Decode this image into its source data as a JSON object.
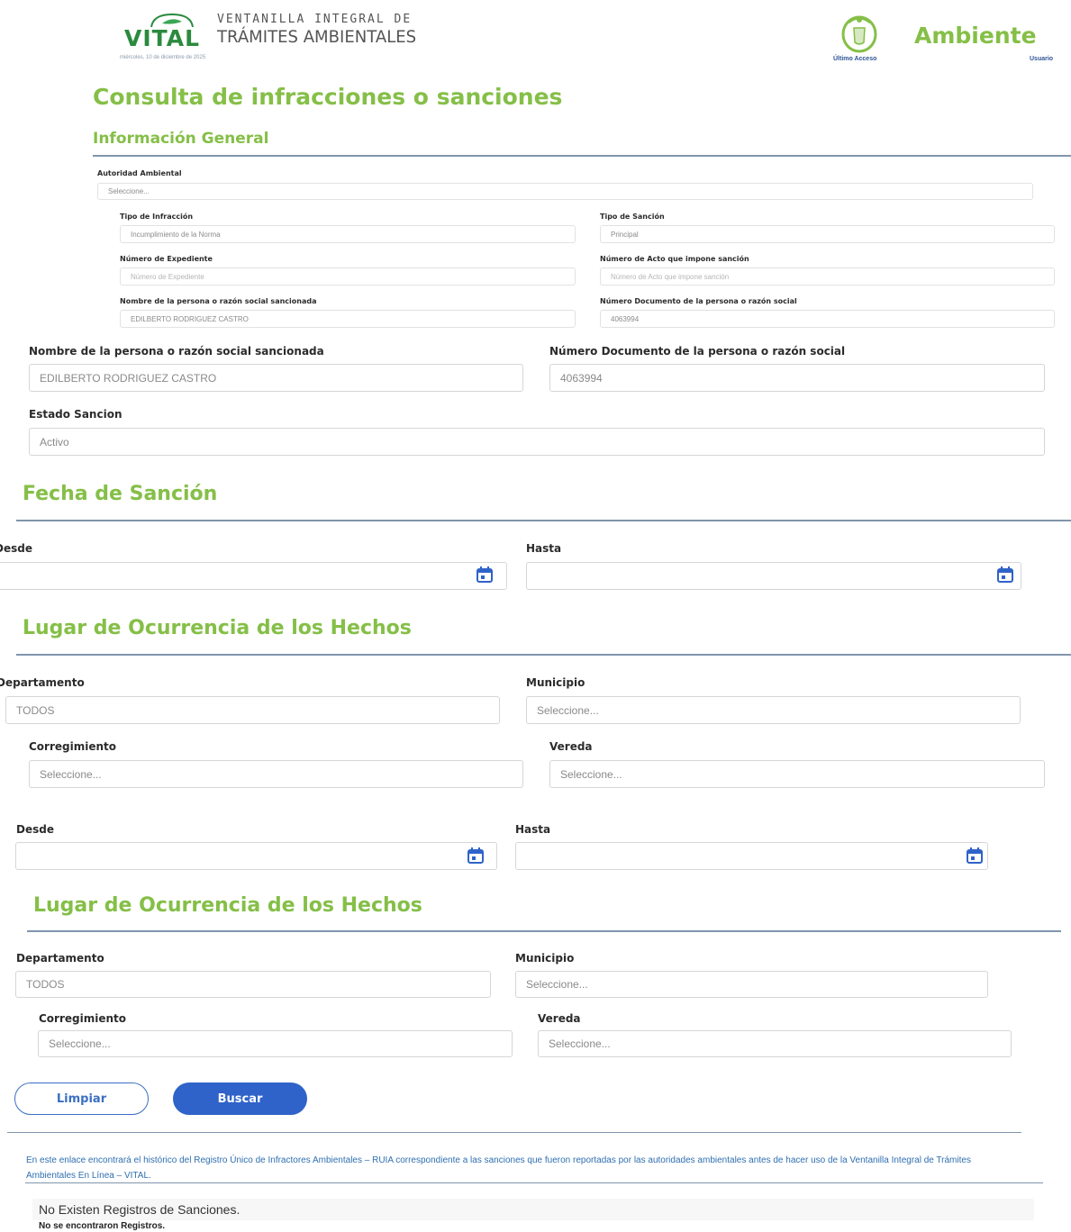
{
  "header": {
    "logo_title": "VITAL",
    "logo_line1": "VENTANILLA INTEGRAL DE",
    "logo_line2": "TRÁMITES AMBIENTALES",
    "date_text": "miércoles, 10 de diciembre de 2025",
    "brand": "Ambiente",
    "last_access_label": "Último Acceso",
    "user_label": "Usuario"
  },
  "page_title": "Consulta de infracciones o sanciones",
  "general": {
    "title": "Información General",
    "autoridad_label": "Autoridad Ambiental",
    "autoridad_value": "Seleccione...",
    "tipo_infraccion_label": "Tipo de Infracción",
    "tipo_infraccion_value": "Incumplimiento de la Norma",
    "tipo_sancion_label": "Tipo de Sanción",
    "tipo_sancion_value": "Principal",
    "num_expediente_label": "Número de Expediente",
    "num_expediente_placeholder": "Número de Expediente",
    "num_acto_label": "Número de Acto que impone sanción",
    "num_acto_placeholder": "Número de Acto que impone sanción",
    "nombre_label": "Nombre de la persona o razón social sancionada",
    "nombre_value": "EDILBERTO RODRIGUEZ CASTRO",
    "documento_label": "Número Documento de la persona o razón social",
    "documento_value": "4063994"
  },
  "detail": {
    "nombre_label": "Nombre de la persona o razón social sancionada",
    "nombre_value": "EDILBERTO RODRIGUEZ CASTRO",
    "documento_label": "Número Documento de la persona o razón social",
    "documento_value": "4063994",
    "estado_label": "Estado Sancion",
    "estado_value": "Activo"
  },
  "fecha": {
    "title": "Fecha de Sanción",
    "desde_label": "Desde",
    "hasta_label": "Hasta"
  },
  "lugar1": {
    "title": "Lugar de Ocurrencia de los Hechos",
    "departamento_label": "Departamento",
    "departamento_value": "TODOS",
    "municipio_label": "Municipio",
    "municipio_value": "Seleccione...",
    "corregimiento_label": "Corregimiento",
    "corregimiento_value": "Seleccione...",
    "vereda_label": "Vereda",
    "vereda_value": "Seleccione..."
  },
  "fecha2": {
    "desde_label": "Desde",
    "hasta_label": "Hasta"
  },
  "lugar2": {
    "title": "Lugar de Ocurrencia de los Hechos",
    "departamento_label": "Departamento",
    "departamento_value": "TODOS",
    "municipio_label": "Municipio",
    "municipio_value": "Seleccione...",
    "corregimiento_label": "Corregimiento",
    "corregimiento_value": "Seleccione...",
    "vereda_label": "Vereda",
    "vereda_value": "Seleccione..."
  },
  "actions": {
    "clear_label": "Limpiar",
    "search_label": "Buscar"
  },
  "footer": {
    "ruia_text": "En este enlace encontrará el histórico del Registro Único de Infractores Ambientales – RUIA correspondiente a las sanciones que fueron reportadas por las autoridades ambientales antes de hacer uso de la Ventanilla Integral de Trámites Ambientales En Línea – VITAL.",
    "no_records": "No Existen Registros de Sanciones.",
    "not_found": "No se encontraron Registros."
  },
  "colors": {
    "green": "#85bf47",
    "primary_blue": "#2f63c9",
    "rule": "#8195ad",
    "vital_green": "#2b8a3e"
  },
  "icons": [
    "vital-logo",
    "ministry-seal-icon",
    "calendar-icon"
  ]
}
